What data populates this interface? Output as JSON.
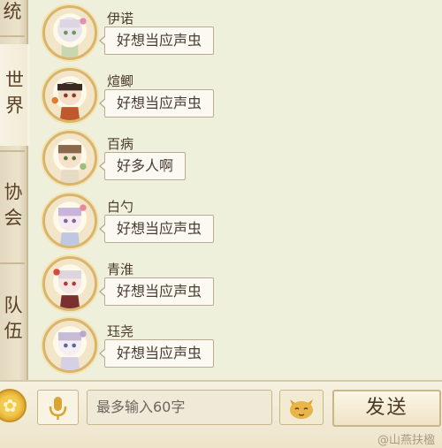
{
  "tabs": [
    {
      "label": "统",
      "active": false
    },
    {
      "label": "世界",
      "active": true
    },
    {
      "label": "协会",
      "active": false
    },
    {
      "label": "队伍",
      "active": false
    }
  ],
  "messages": [
    {
      "name": "伊诺",
      "text": "好想当应声虫"
    },
    {
      "name": "煊鲫",
      "text": "好想当应声虫"
    },
    {
      "name": "百病",
      "text": "好多人啊"
    },
    {
      "name": "白勺",
      "text": "好想当应声虫"
    },
    {
      "name": "青淮",
      "text": "好想当应声虫"
    },
    {
      "name": "珏尧",
      "text": "好想当应声虫"
    }
  ],
  "input": {
    "placeholder": "最多输入60字"
  },
  "buttons": {
    "send": "发送"
  },
  "watermark": "@山燕扶楹",
  "icons": {
    "settings": "gear-icon",
    "voice": "microphone-icon",
    "emoji": "cat-face-icon"
  }
}
